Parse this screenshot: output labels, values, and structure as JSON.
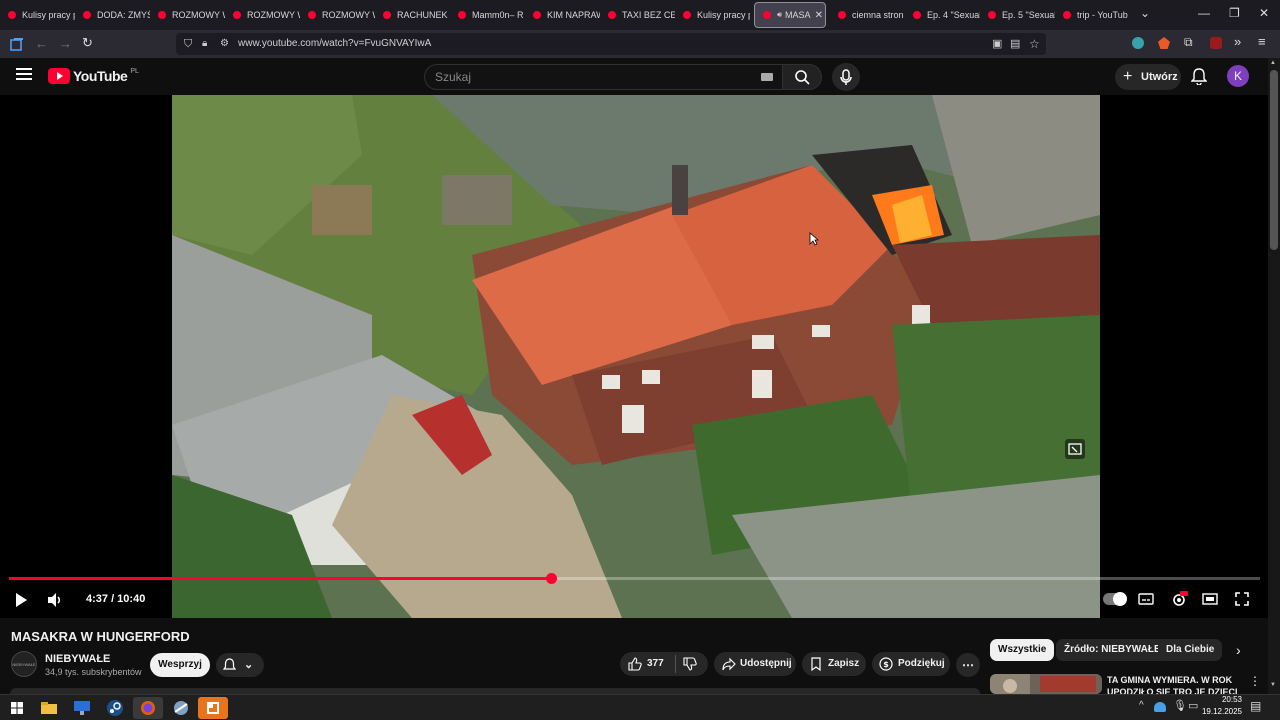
{
  "browser": {
    "tabs": [
      {
        "title": "Kulisy pracy p"
      },
      {
        "title": "DODA: ZMYŚ"
      },
      {
        "title": "ROZMOWY W"
      },
      {
        "title": "ROZMOWY W"
      },
      {
        "title": "ROZMOWY W"
      },
      {
        "title": "RACHUNEK S"
      },
      {
        "title": "Mamm0n– R"
      },
      {
        "title": "KIM NAPRAW"
      },
      {
        "title": "TAXI BEZ CEN"
      },
      {
        "title": "Kulisy pracy p"
      },
      {
        "title": "MASA",
        "active": true,
        "audio": true
      },
      {
        "title": "ciemna stron"
      },
      {
        "title": "Ep. 4 \"Sexual"
      },
      {
        "title": "Ep. 5 \"Sexual"
      },
      {
        "title": "trip - YouTub"
      }
    ],
    "url": "www.youtube.com/watch?v=FvuGNVAYIwA"
  },
  "youtube": {
    "logo_text": "YouTube",
    "region": "PL",
    "search_placeholder": "Szukaj",
    "create_label": "Utwórz",
    "avatar_letter": "K",
    "brand_color": "#ff0033"
  },
  "player": {
    "current_time": "4:37",
    "duration": "10:40",
    "time_display": "4:37 / 10:40",
    "progress_fraction": 0.433
  },
  "video": {
    "title": "MASAKRA W HUNGERFORD",
    "channel_name": "NIEBYWAŁE",
    "channel_avatar_text": "NIEBYWAŁE",
    "subscribers": "34,9 tys. subskrybentów",
    "support_label": "Wesprzyj",
    "likes": "377",
    "share_label": "Udostępnij",
    "save_label": "Zapisz",
    "thanks_label": "Podziękuj"
  },
  "sidebar": {
    "chips": [
      "Wszystkie",
      "Źródło: NIEBYWAŁE",
      "Dla Ciebie"
    ],
    "recommendation_title": "TA GMINA WYMIERA. W ROK UPODZIŁO SIĘ TRO JE DZIECI"
  },
  "taskbar": {
    "time": "20:53",
    "date": "19.12.2025"
  }
}
